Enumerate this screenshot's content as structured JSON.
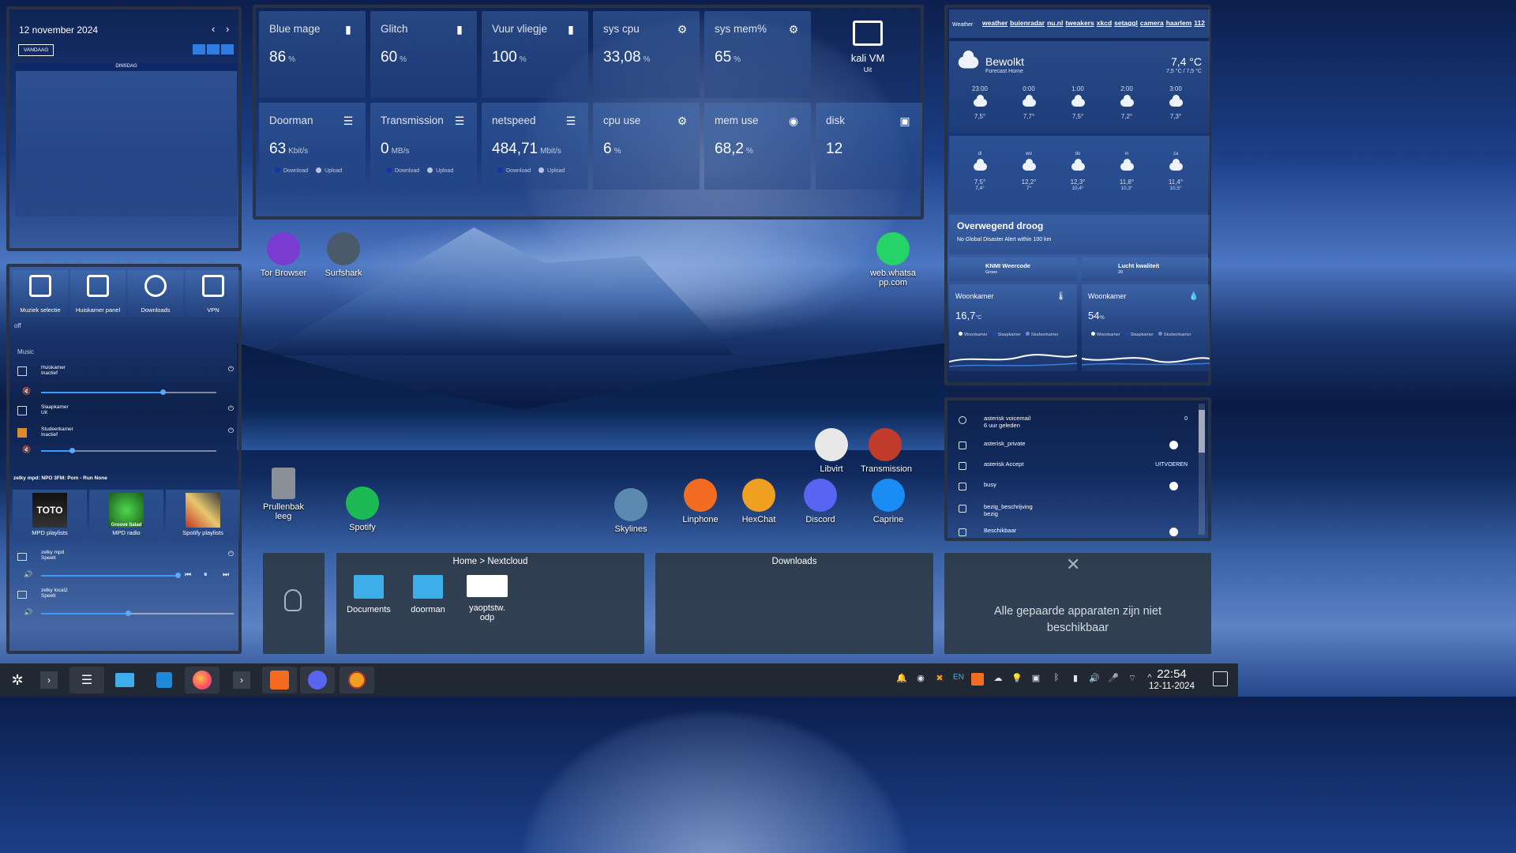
{
  "calendar": {
    "date": "12 november 2024",
    "today": "VANDAAG",
    "weekday": "DINSDAG",
    "prev": "‹",
    "next": "›"
  },
  "stats": [
    {
      "title": "Blue mage",
      "value": "86",
      "unit": "%",
      "icon": "battery-icon"
    },
    {
      "title": "Glitch",
      "value": "60",
      "unit": "%",
      "icon": "battery-icon"
    },
    {
      "title": "Vuur vliegje",
      "value": "100",
      "unit": "%",
      "icon": "battery-icon"
    },
    {
      "title": "sys cpu",
      "value": "33,08",
      "unit": "%",
      "icon": "chip-icon"
    },
    {
      "title": "sys mem%",
      "value": "65",
      "unit": "%",
      "icon": "chip-icon"
    },
    {
      "title": "Doorman",
      "value": "63",
      "unit": "Kbit/s",
      "icon": "server-icon",
      "legend": [
        "Download",
        "Upload"
      ]
    },
    {
      "title": "Transmission",
      "value": "0",
      "unit": "MB/s",
      "icon": "server-icon",
      "legend": [
        "Download",
        "Upload"
      ]
    },
    {
      "title": "netspeed",
      "value": "484,71",
      "unit": "Mbit/s",
      "icon": "server-icon",
      "legend": [
        "Download",
        "Upload"
      ]
    },
    {
      "title": "cpu use",
      "value": "6",
      "unit": "%",
      "icon": "chip-icon"
    },
    {
      "title": "mem use",
      "value": "68,2",
      "unit": "%",
      "icon": "eye-icon"
    },
    {
      "title": "disk",
      "value": "12",
      "unit": "",
      "icon": "disk-icon"
    }
  ],
  "vm": {
    "name": "kali VM",
    "state": "Uit"
  },
  "media": {
    "shortcuts": [
      "Muziek selectie",
      "Huiskamer panel",
      "Downloads",
      "VPN"
    ],
    "off": "off",
    "section": "Music",
    "players": [
      {
        "name": "Huiskamer",
        "state": "Inactief"
      },
      {
        "name": "Slaapkamer",
        "state": "Uit"
      },
      {
        "name": "Studeerkamer",
        "state": "Inactief"
      }
    ],
    "now_playing": "zelky mpd: NPO 3FM: Pom - Run None",
    "playlists": [
      "MPD playlists",
      "MPD radio",
      "Spotify playlists"
    ],
    "album_texts": [
      "TOTO",
      "Groove Salad"
    ],
    "players2": [
      {
        "name": "zelky mpd",
        "state": "Speelt"
      },
      {
        "name": "zelky local2",
        "state": "Speelt"
      }
    ]
  },
  "desktop": [
    {
      "label": "Tor Browser",
      "color": "#7a3bd0"
    },
    {
      "label": "Surfshark",
      "color": "#4a5a6a"
    },
    {
      "label": "web.whatsa pp.com",
      "color": "#25d366"
    },
    {
      "label": "Libvirt",
      "color": "#e8e8e8"
    },
    {
      "label": "Transmission",
      "color": "#c23a2a"
    },
    {
      "label": "Prullenbak leeg",
      "color": "#8a9098"
    },
    {
      "label": "Spotify",
      "color": "#1db954"
    },
    {
      "label": "Skylines",
      "color": "#5a8ab0"
    },
    {
      "label": "Linphone",
      "color": "#f26d21"
    },
    {
      "label": "HexChat",
      "color": "#f0a020"
    },
    {
      "label": "Discord",
      "color": "#5865f2"
    },
    {
      "label": "Caprine",
      "color": "#1a8cf5"
    }
  ],
  "weather": {
    "links_label": "Weather",
    "links": [
      "weather",
      "buienradar",
      "nu.nl",
      "tweakers",
      "xkcd",
      "setaggl",
      "camera",
      "haarlem",
      "112"
    ],
    "condition": "Bewolkt",
    "source": "Forecast Home",
    "temp": "7,4 °C",
    "range": "7,5 °C / 7,5 °C",
    "hourly": [
      {
        "t": "23:00",
        "v": "7,5°"
      },
      {
        "t": "0:00",
        "v": "7,7°"
      },
      {
        "t": "1:00",
        "v": "7,5°"
      },
      {
        "t": "2:00",
        "v": "7,2°"
      },
      {
        "t": "3:00",
        "v": "7,3°"
      }
    ],
    "daily": [
      {
        "d": "di",
        "hi": "7,5°",
        "lo": "7,4°"
      },
      {
        "d": "wo",
        "hi": "12,2°",
        "lo": "7°"
      },
      {
        "d": "do",
        "hi": "12,3°",
        "lo": "10,4°"
      },
      {
        "d": "vr",
        "hi": "11,8°",
        "lo": "10,3°"
      },
      {
        "d": "za",
        "hi": "11,4°",
        "lo": "10,5°"
      }
    ],
    "summary": "Overwegend droog",
    "alert": "No Global Disaster Alert within 100 km",
    "knmi": "KNMI Weercode",
    "knmi_sub": "Groen",
    "air": "Lucht kwaliteit",
    "air_sub": "20",
    "sensor1": {
      "name": "Woonkamer",
      "value": "16,7",
      "unit": "°C"
    },
    "sensor2": {
      "name": "Woonkamer",
      "value": "54",
      "unit": "%"
    },
    "sensor_legend": [
      "Woonkamer",
      "Slaapkamer",
      "Studeerkamer"
    ]
  },
  "automations": [
    {
      "name": "asterisk voicemail",
      "sub": "6 uur geleden",
      "value": "0"
    },
    {
      "name": "asterisk_private",
      "sub": "",
      "value": ""
    },
    {
      "name": "asterisk Accept",
      "sub": "",
      "value": "UITVOEREN"
    },
    {
      "name": "busy",
      "sub": "",
      "value": ""
    },
    {
      "name": "bezig_beschrijving",
      "sub": "bezig",
      "value": ""
    },
    {
      "name": "Beschikbaar",
      "sub": "",
      "value": ""
    }
  ],
  "folder1": {
    "title": "Home > Nextcloud",
    "items": [
      "Documents",
      "doorman",
      "yaoptstw. odp"
    ]
  },
  "folder2": {
    "title": "Downloads"
  },
  "bluetooth": {
    "message": "Alle gepaarde apparaten zijn niet beschikbaar"
  },
  "clock": {
    "time": "22:54",
    "date": "12-11-2024"
  },
  "tray": {
    "lang": "EN"
  }
}
